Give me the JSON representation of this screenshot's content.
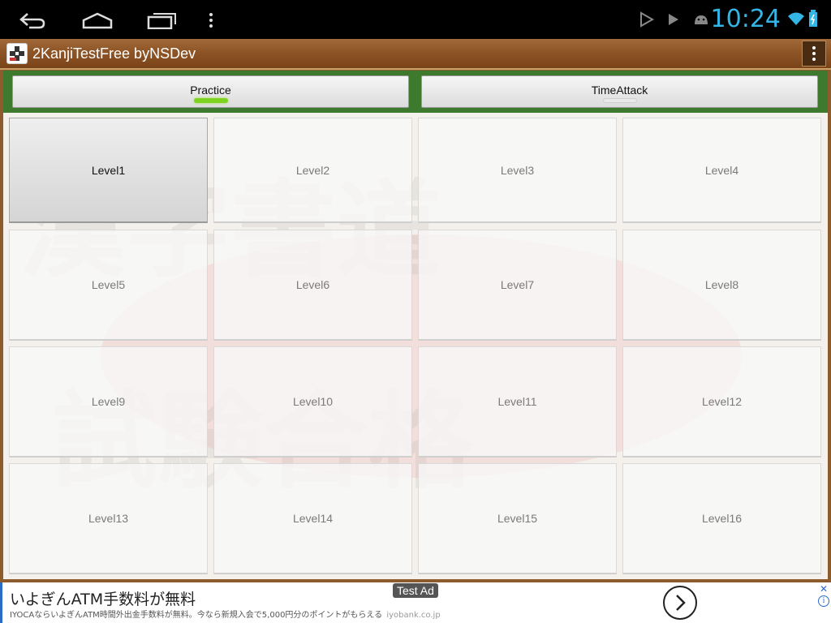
{
  "status_bar": {
    "time": "10:24",
    "accent_color": "#33b5e5",
    "nav_icons": [
      "back-icon",
      "home-icon",
      "recent-apps-icon",
      "menu-icon"
    ],
    "notification_icons": [
      "play-store-icon",
      "play-icon",
      "android-icon"
    ],
    "system_icons": [
      "wifi-icon",
      "battery-icon"
    ]
  },
  "action_bar": {
    "title": "2KanjiTestFree byNSDev",
    "icon": "app-icon",
    "overflow_icon": "overflow-menu-icon"
  },
  "mode_tabs": [
    {
      "label": "Practice",
      "selected": true,
      "indicator_color": "#7ed321"
    },
    {
      "label": "TimeAttack",
      "selected": false,
      "indicator_color": "#e6e6e6"
    }
  ],
  "levels": [
    {
      "label": "Level1",
      "active": true
    },
    {
      "label": "Level2",
      "active": false
    },
    {
      "label": "Level3",
      "active": false
    },
    {
      "label": "Level4",
      "active": false
    },
    {
      "label": "Level5",
      "active": false
    },
    {
      "label": "Level6",
      "active": false
    },
    {
      "label": "Level7",
      "active": false
    },
    {
      "label": "Level8",
      "active": false
    },
    {
      "label": "Level9",
      "active": false
    },
    {
      "label": "Level10",
      "active": false
    },
    {
      "label": "Level11",
      "active": false
    },
    {
      "label": "Level12",
      "active": false
    },
    {
      "label": "Level13",
      "active": false
    },
    {
      "label": "Level14",
      "active": false
    },
    {
      "label": "Level15",
      "active": false
    },
    {
      "label": "Level16",
      "active": false
    }
  ],
  "ad": {
    "tag": "Test Ad",
    "headline": "いよぎんATM手数料が無料",
    "body": "IYOCAならいよぎんATM時間外出金手数料が無料。今なら新規入会で5,000円分のポイントがもらえる",
    "domain": "iyobank.co.jp",
    "arrow_icon": "chevron-right-icon",
    "close_icon": "close-icon",
    "info_icon": "info-icon"
  }
}
